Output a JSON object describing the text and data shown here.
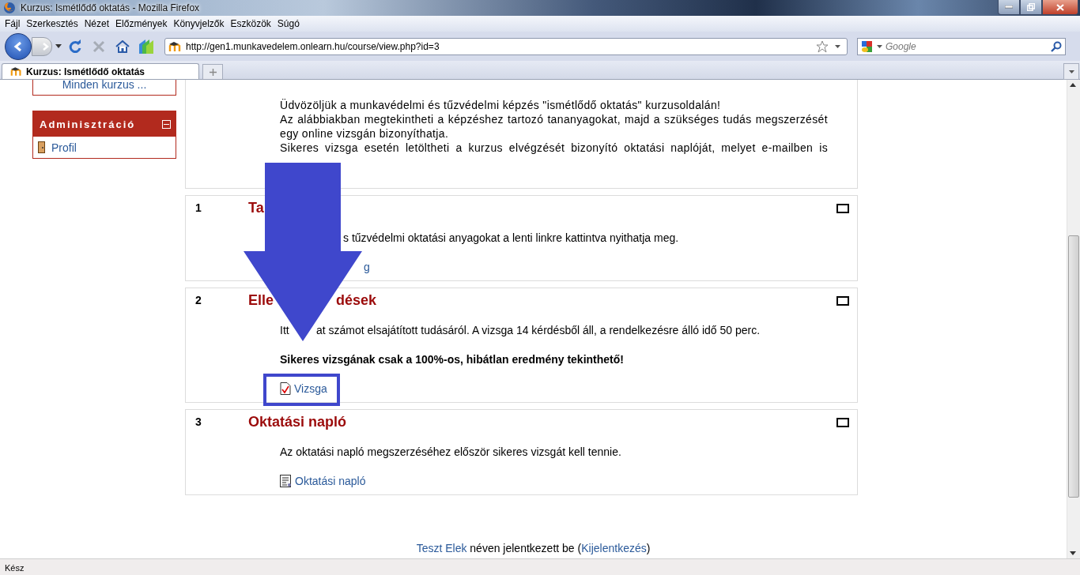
{
  "window": {
    "title": "Kurzus: Ismétlődő oktatás - Mozilla Firefox"
  },
  "menu": [
    "Fájl",
    "Szerkesztés",
    "Nézet",
    "Előzmények",
    "Könyvjelzők",
    "Eszközök",
    "Súgó"
  ],
  "address": {
    "value": "http://gen1.munkavedelem.onlearn.hu/course/view.php?id=3"
  },
  "search": {
    "placeholder": "Google"
  },
  "tabs": [
    {
      "label": "Kurzus: Ismétlődő oktatás",
      "selected": true
    }
  ],
  "sidebar": {
    "blocks": [
      {
        "items": [
          {
            "label": "Minden kurzus ..."
          }
        ]
      },
      {
        "title": "Adminisztráció",
        "items": [
          {
            "label": "Profil"
          }
        ]
      }
    ]
  },
  "intro": {
    "paragraphs": [
      "Üdvözöljük a munkavédelmi és tűzvédelmi képzés \"ismétlődő oktatás\" kurzusoldalán!",
      "Az alábbiakban megtekintheti a képzéshez tartozó tananyagokat, majd a szükséges tudás megszerzését egy online vizsgán bizonyíthatja.",
      "Sikeres vizsga esetén letöltheti a kurzus elvégzését bizonyító oktatási naplóját, melyet e-mailben is"
    ]
  },
  "sections": [
    {
      "number": "1",
      "title": [
        "Ta"
      ],
      "paragraphs": [
        {
          "parts": [
            "s tűzvédelmi oktatási anyagokat a lenti linkre kattintva nyithatja meg."
          ],
          "bold": false
        }
      ],
      "links": [
        {
          "label": "g",
          "kind": "hidden-icon"
        }
      ]
    },
    {
      "number": "2",
      "title": [
        "Elle",
        "dések"
      ],
      "paragraphs": [
        {
          "parts": [
            "Itt",
            "at számot elsajátított tudásáról. A vizsga 14 kérdésből áll, a rendelkezésre álló idő 50 perc."
          ],
          "bold": false
        },
        {
          "parts": [
            "Sikeres vizsgának csak a 100%-os, hibátlan eredmény tekinthető!"
          ],
          "bold": true
        }
      ],
      "links": [
        {
          "label": "Vizsga",
          "kind": "quiz"
        }
      ]
    },
    {
      "number": "3",
      "title": [
        "Oktatási napló"
      ],
      "paragraphs": [
        {
          "parts": [
            "Az oktatási napló megszerzéséhez először sikeres vizsgát kell tennie."
          ],
          "bold": false
        }
      ],
      "links": [
        {
          "label": "Oktatási napló",
          "kind": "resource"
        }
      ]
    }
  ],
  "footer": {
    "user": "Teszt Elek",
    "text": "néven jelentkezett be",
    "open": "(",
    "logout": "Kijelentkezés",
    "close": ")"
  },
  "status_bar": "Kész"
}
